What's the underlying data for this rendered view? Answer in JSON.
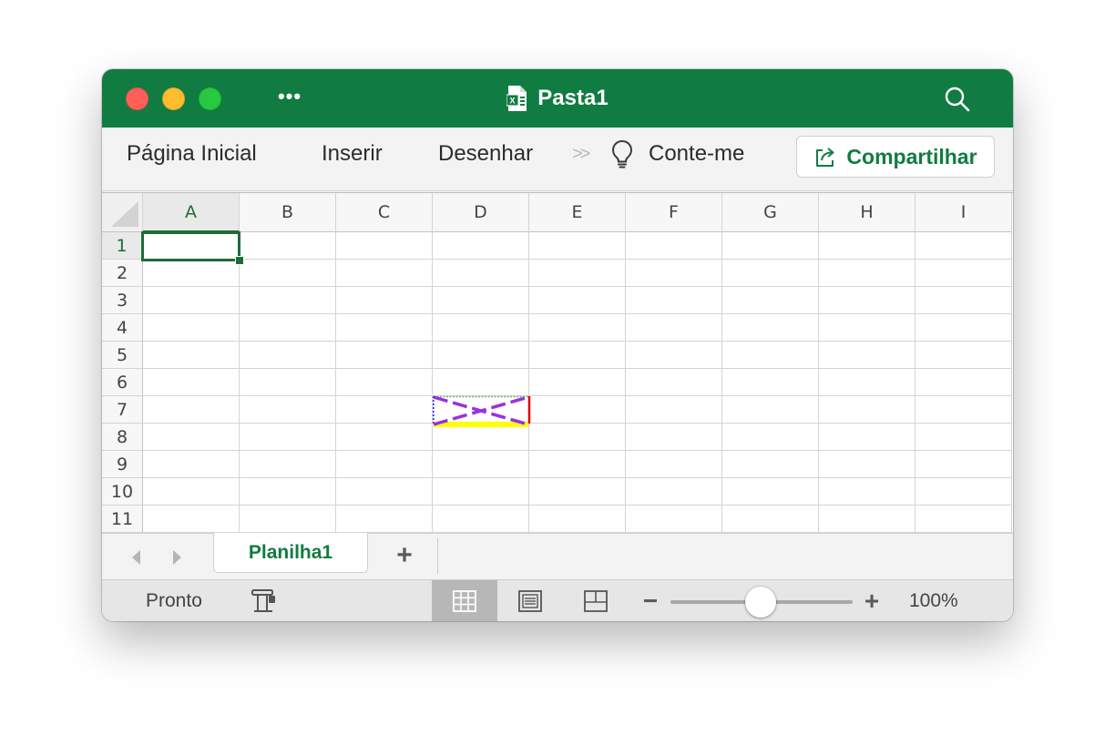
{
  "window": {
    "title": "Pasta1",
    "accent_color": "#107c41",
    "icons": [
      "more-icon",
      "excel-doc-icon",
      "search-icon"
    ]
  },
  "ribbon": {
    "tabs": [
      "Página Inicial",
      "Inserir",
      "Desenhar",
      "Conte-me"
    ],
    "overflow_icon": "chevron-double-right-icon",
    "tell_me_icon": "lightbulb-icon",
    "share_label": "Compartilhar",
    "share_icon": "share-icon"
  },
  "grid": {
    "columns": [
      "A",
      "B",
      "C",
      "D",
      "E",
      "F",
      "G",
      "H",
      "I"
    ],
    "rows": [
      "1",
      "2",
      "3",
      "4",
      "5",
      "6",
      "7",
      "8",
      "9",
      "10",
      "11"
    ],
    "active_cell": "A1",
    "border_colors": {
      "selection": "#1e6b3a",
      "diagonal": "#9b30e0",
      "top": "#5ec25e",
      "bottom": "#ffff00",
      "left": "#1a1aff",
      "right": "#e00000"
    }
  },
  "sheets": {
    "tabs": [
      "Planilha1"
    ],
    "active": "Planilha1",
    "add_label": "+"
  },
  "status": {
    "text": "Pronto",
    "zoom_minus": "−",
    "zoom_plus": "+",
    "zoom_level": "100%",
    "zoom_fraction": 0.5
  }
}
